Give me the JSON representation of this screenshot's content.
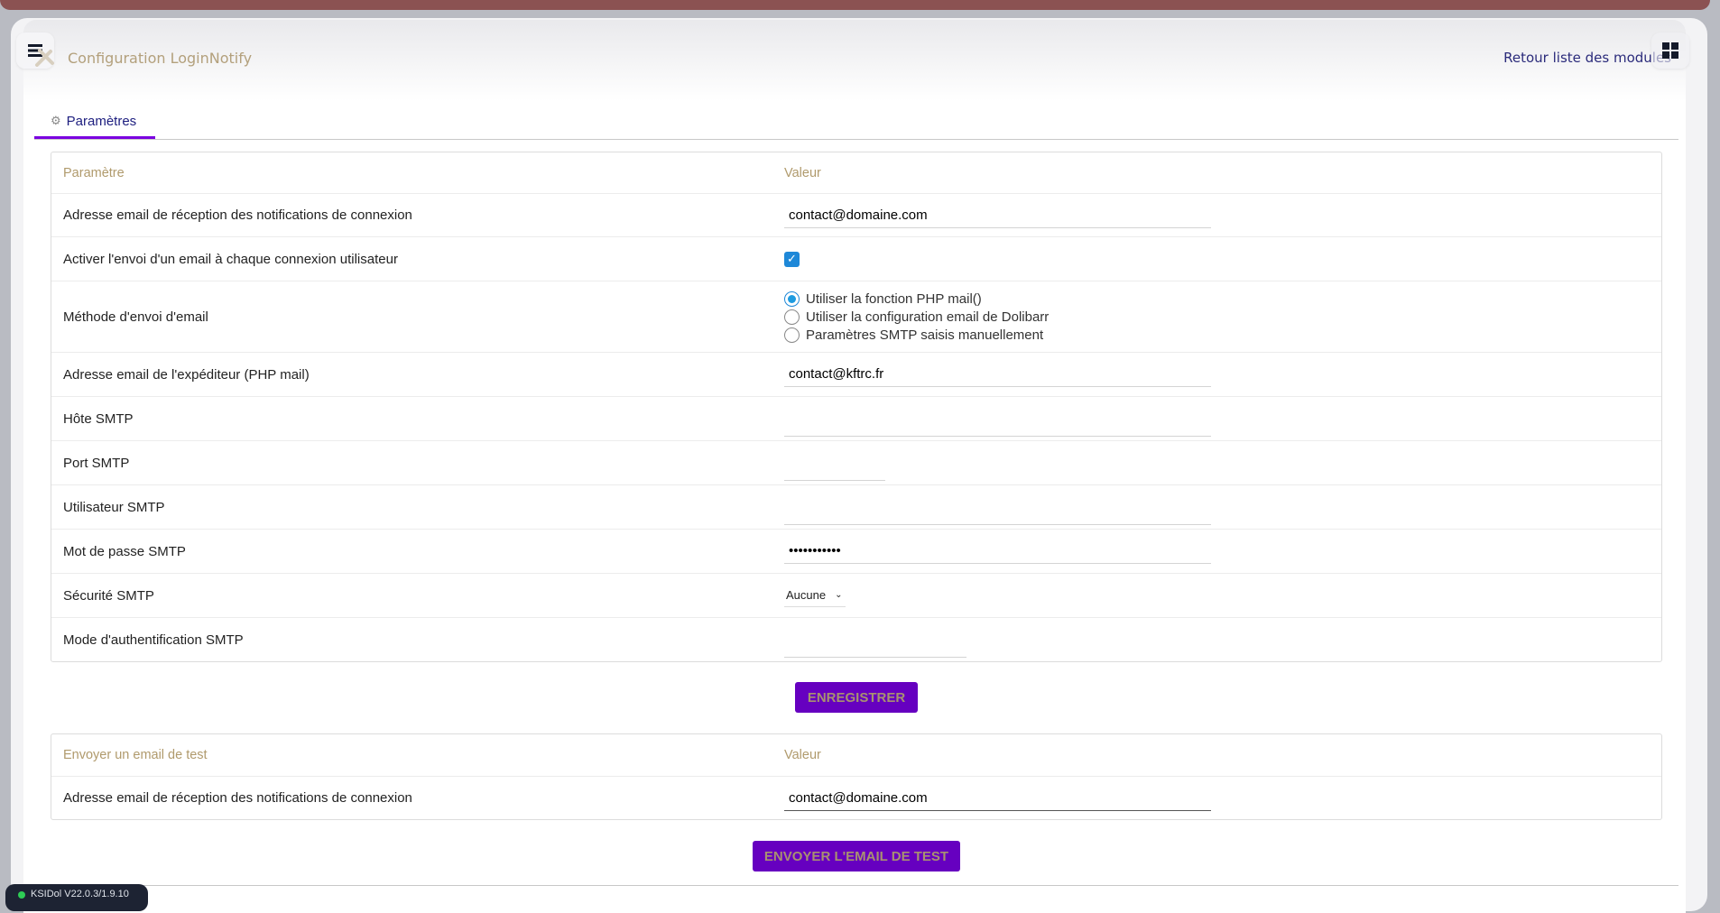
{
  "header": {
    "title": "Configuration LoginNotify",
    "back_link": "Retour liste des modules"
  },
  "tabs": [
    {
      "label": "Paramètres"
    }
  ],
  "settings_table": {
    "col_param": "Paramètre",
    "col_value": "Valeur",
    "rows": {
      "notify_email": {
        "label": "Adresse email de réception des notifications de connexion",
        "value": "contact@domaine.com"
      },
      "enable": {
        "label": "Activer l'envoi d'un email à chaque connexion utilisateur",
        "checked": true
      },
      "method": {
        "label": "Méthode d'envoi d'email",
        "options": [
          "Utiliser la fonction PHP mail()",
          "Utiliser la configuration email de Dolibarr",
          "Paramètres SMTP saisis manuellement"
        ],
        "selected": 0
      },
      "sender": {
        "label": "Adresse email de l'expéditeur (PHP mail)",
        "value": "contact@kftrc.fr"
      },
      "host": {
        "label": "Hôte SMTP",
        "value": ""
      },
      "port": {
        "label": "Port SMTP",
        "value": ""
      },
      "user": {
        "label": "Utilisateur SMTP",
        "value": ""
      },
      "password": {
        "label": "Mot de passe SMTP",
        "value": "•••••••••••"
      },
      "security": {
        "label": "Sécurité SMTP",
        "value": "Aucune"
      },
      "auth": {
        "label": "Mode d'authentification SMTP",
        "value": ""
      }
    }
  },
  "save_button": "ENREGISTRER",
  "test_table": {
    "col_param": "Envoyer un email de test",
    "col_value": "Valeur",
    "row_label": "Adresse email de réception des notifications de connexion",
    "row_value": "contact@domaine.com"
  },
  "test_button": "ENVOYER L'EMAIL DE TEST",
  "version_badge": "KSIDol V22.0.3/1.9.10",
  "colors": {
    "accent": "#6600c0",
    "topbar": "#8b5252",
    "checkbox": "#1e88d8"
  }
}
